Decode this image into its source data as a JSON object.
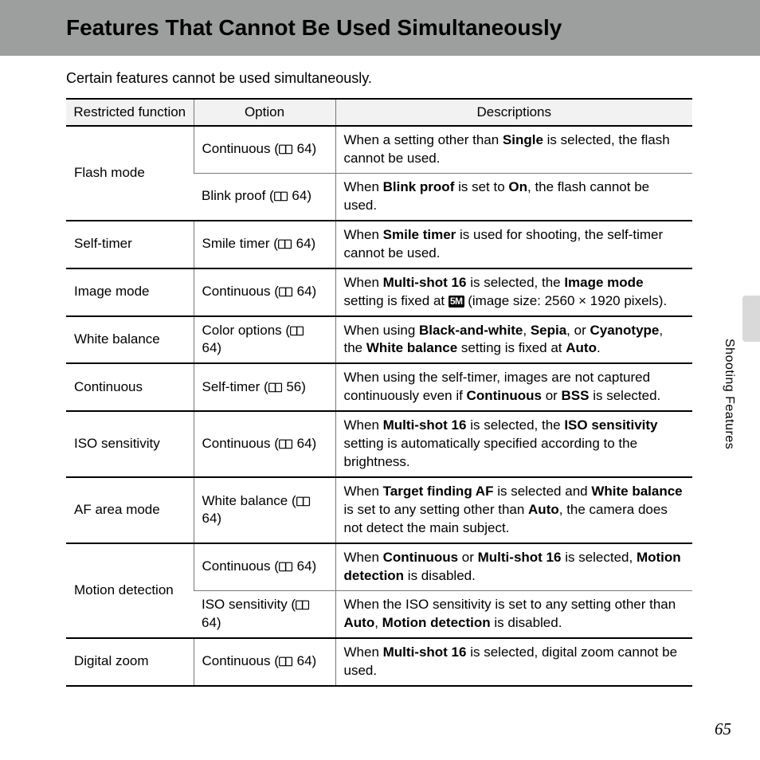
{
  "title": "Features That Cannot Be Used Simultaneously",
  "intro": "Certain features cannot be used simultaneously.",
  "headers": {
    "c1": "Restricted function",
    "c2": "Option",
    "c3": "Descriptions"
  },
  "ref": {
    "page64": "64",
    "page56": "56"
  },
  "badge": "5M",
  "rows": {
    "flash_func": "Flash mode",
    "flash_opt1_a": "Continuous (",
    "flash_opt1_b": " 64)",
    "flash_desc1_a": "When a setting other than ",
    "flash_desc1_b": "Single",
    "flash_desc1_c": " is selected, the flash cannot be used.",
    "flash_opt2_a": "Blink proof (",
    "flash_opt2_b": " 64)",
    "flash_desc2_a": "When ",
    "flash_desc2_b": "Blink proof",
    "flash_desc2_c": " is set to ",
    "flash_desc2_d": "On",
    "flash_desc2_e": ", the flash cannot be used.",
    "self_func": "Self-timer",
    "self_opt_a": "Smile timer (",
    "self_opt_b": " 64)",
    "self_desc_a": "When ",
    "self_desc_b": "Smile timer",
    "self_desc_c": " is used for shooting, the self-timer cannot be used.",
    "img_func": "Image mode",
    "img_opt_a": "Continuous (",
    "img_opt_b": " 64)",
    "img_desc_a": "When ",
    "img_desc_b": "Multi-shot 16",
    "img_desc_c": " is selected, the ",
    "img_desc_d": "Image mode",
    "img_desc_e": " setting is fixed at ",
    "img_desc_f": " (image size: 2560 × 1920 pixels).",
    "wb_func": "White balance",
    "wb_opt_a": "Color options (",
    "wb_opt_b": " 64)",
    "wb_desc_a": "When using ",
    "wb_desc_b": "Black-and-white",
    "wb_desc_c": ", ",
    "wb_desc_d": "Sepia",
    "wb_desc_e": ", or ",
    "wb_desc_f": "Cyanotype",
    "wb_desc_g": ", the ",
    "wb_desc_h": "White balance",
    "wb_desc_i": " setting is fixed at ",
    "wb_desc_j": "Auto",
    "wb_desc_k": ".",
    "cont_func": "Continuous",
    "cont_opt_a": "Self-timer (",
    "cont_opt_b": " 56)",
    "cont_desc_a": "When using the self-timer, images are not captured continuously even if ",
    "cont_desc_b": "Continuous",
    "cont_desc_c": " or ",
    "cont_desc_d": "BSS",
    "cont_desc_e": " is selected.",
    "iso_func": "ISO sensitivity",
    "iso_opt_a": "Continuous (",
    "iso_opt_b": " 64)",
    "iso_desc_a": "When ",
    "iso_desc_b": "Multi-shot 16",
    "iso_desc_c": " is selected, the ",
    "iso_desc_d": "ISO sensitivity",
    "iso_desc_e": " setting is automatically specified according to the brightness.",
    "af_func": "AF area mode",
    "af_opt_a": "White balance (",
    "af_opt_b": " 64)",
    "af_desc_a": "When ",
    "af_desc_b": "Target finding AF",
    "af_desc_c": " is selected and ",
    "af_desc_d": "White balance",
    "af_desc_e": " is set to any setting other than ",
    "af_desc_f": "Auto",
    "af_desc_g": ", the camera does not detect the main subject.",
    "md_func": "Motion detection",
    "md_opt1_a": "Continuous (",
    "md_opt1_b": " 64)",
    "md_desc1_a": "When ",
    "md_desc1_b": "Continuous",
    "md_desc1_c": " or ",
    "md_desc1_d": "Multi-shot 16",
    "md_desc1_e": " is selected, ",
    "md_desc1_f": "Motion detection",
    "md_desc1_g": " is disabled.",
    "md_opt2_a": "ISO sensitivity (",
    "md_opt2_b": " 64)",
    "md_desc2_a": "When the ISO sensitivity is set to any setting other than ",
    "md_desc2_b": "Auto",
    "md_desc2_c": ", ",
    "md_desc2_d": "Motion detection",
    "md_desc2_e": " is disabled.",
    "dz_func": "Digital zoom",
    "dz_opt_a": "Continuous (",
    "dz_opt_b": " 64)",
    "dz_desc_a": "When ",
    "dz_desc_b": "Multi-shot 16",
    "dz_desc_c": " is selected, digital zoom cannot be used."
  },
  "side_label": "Shooting Features",
  "page_number": "65"
}
